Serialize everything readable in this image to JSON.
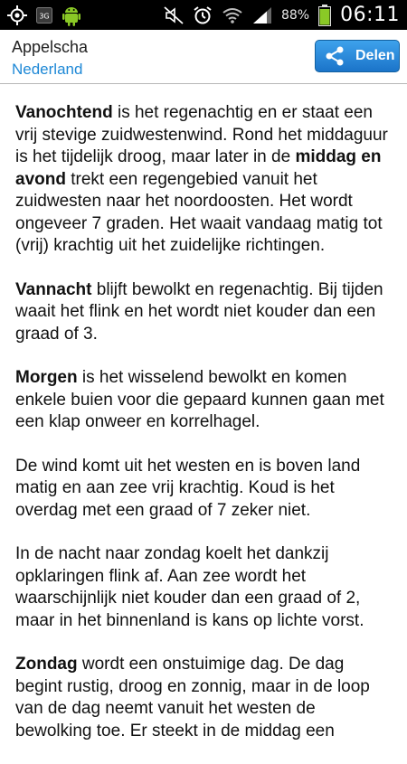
{
  "status_bar": {
    "network_type": "3G",
    "battery_percent": "88%",
    "time": "06:11",
    "icons": [
      "gps-crosshair-icon",
      "3g-icon",
      "android-robot-icon",
      "mute-icon",
      "alarm-icon",
      "wifi-icon",
      "signal-icon",
      "battery-icon"
    ]
  },
  "header": {
    "title": "Appelscha",
    "subtitle": "Nederland",
    "share_label": "Delen",
    "share_icon": "share-icon"
  },
  "colors": {
    "link_blue": "#1e88d6",
    "button_top": "#3ea2ec",
    "button_bottom": "#1b74c9",
    "battery_green": "#8ac926"
  },
  "paragraphs": [
    {
      "lead": "Vanochtend",
      "rest": " is het regenachtig en er staat een vrij stevige zuidwestenwind. Rond het middaguur is het tijdelijk droog, maar later in de ",
      "lead2": "middag en avond",
      "rest2": " trekt een regengebied vanuit het zuidwesten naar het noordoosten. Het wordt ongeveer 7 graden. Het waait vandaag matig tot (vrij) krachtig uit het zuidelijke richtingen."
    },
    {
      "lead": "Vannacht",
      "rest": " blijft bewolkt en regenachtig. Bij tijden waait het flink en het wordt niet kouder dan een graad of 3."
    },
    {
      "lead": "Morgen",
      "rest": " is het wisselend bewolkt en komen enkele buien voor die gepaard kunnen gaan met een klap onweer en korrelhagel."
    },
    {
      "lead": "",
      "rest": "De wind komt uit het westen en is boven land matig en aan zee vrij krachtig. Koud is het overdag met een graad of 7 zeker niet."
    },
    {
      "lead": "",
      "rest": "In de nacht naar zondag koelt het dankzij opklaringen flink af. Aan zee wordt het waarschijnlijk niet kouder dan een graad of 2, maar in het binnenland is kans op lichte vorst."
    },
    {
      "lead": "Zondag",
      "rest": " wordt een onstuimige dag. De dag begint rustig, droog en zonnig, maar in de loop van de dag neemt vanuit het westen de bewolking toe. Er steekt in de middag een"
    }
  ]
}
